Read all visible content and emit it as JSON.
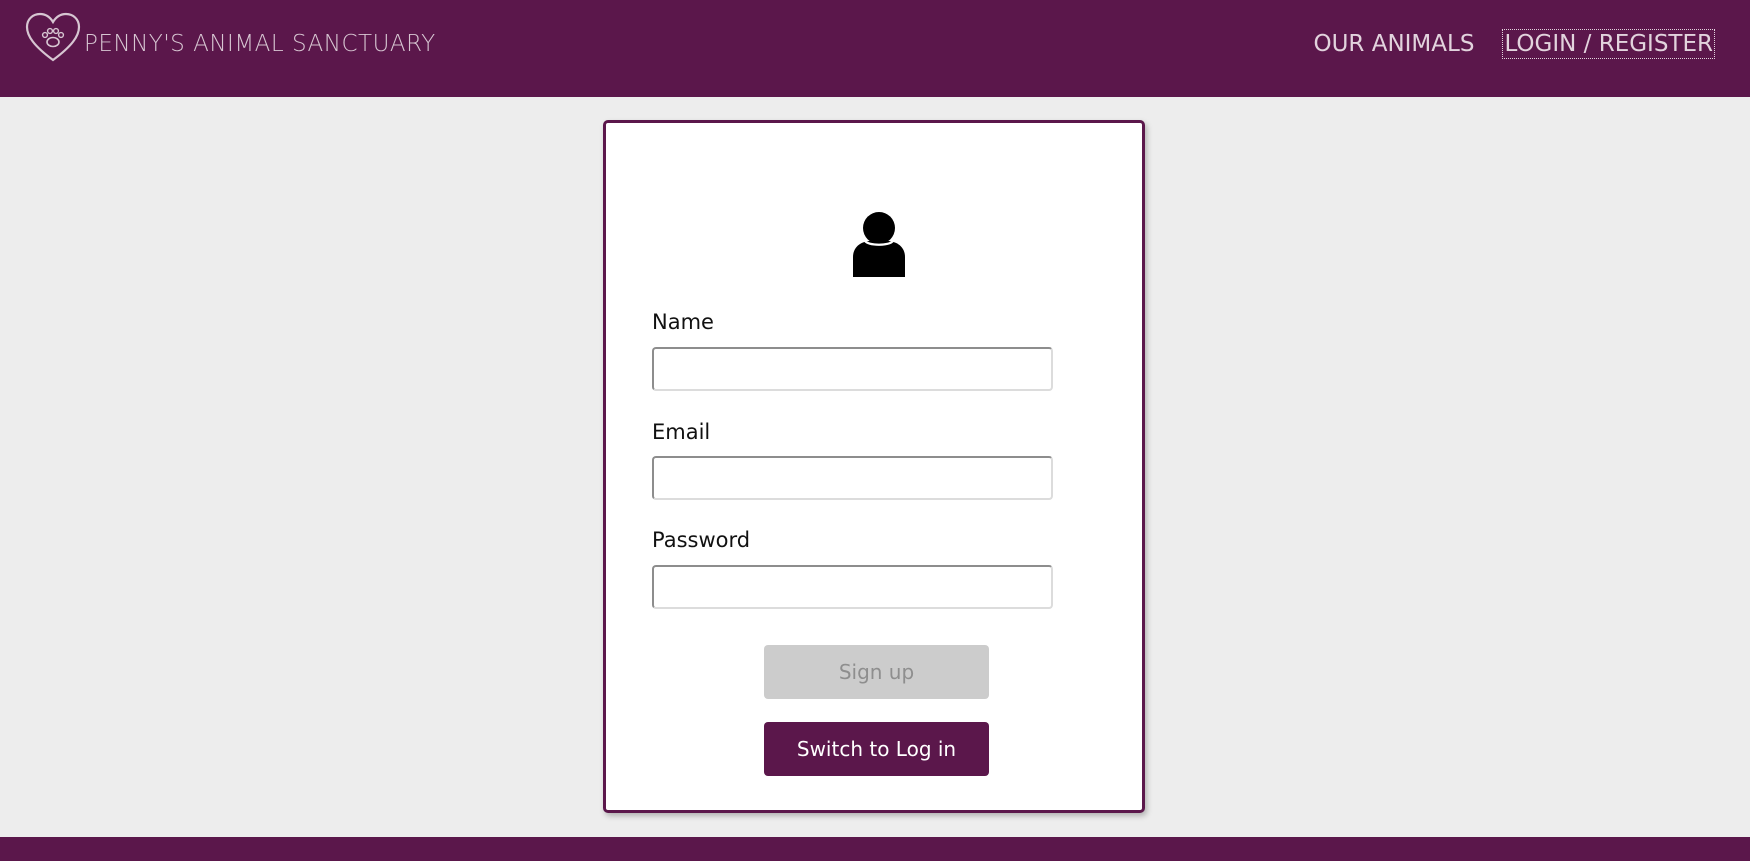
{
  "header": {
    "brand": "PENNY'S ANIMAL SANCTUARY",
    "logo_icon": "heart-paw-icon",
    "nav": {
      "our_animals": "OUR ANIMALS",
      "login_register": "LOGIN / REGISTER"
    }
  },
  "form": {
    "avatar_icon": "user-icon",
    "fields": [
      {
        "label": "Name",
        "value": "",
        "placeholder": ""
      },
      {
        "label": "Email",
        "value": "",
        "placeholder": ""
      },
      {
        "label": "Password",
        "value": "",
        "placeholder": ""
      }
    ],
    "signup_label": "Sign up",
    "switch_label": "Switch to Log in"
  },
  "colors": {
    "brand": "#5b174b",
    "background": "#ededed",
    "disabled_button": "#cccccc"
  }
}
